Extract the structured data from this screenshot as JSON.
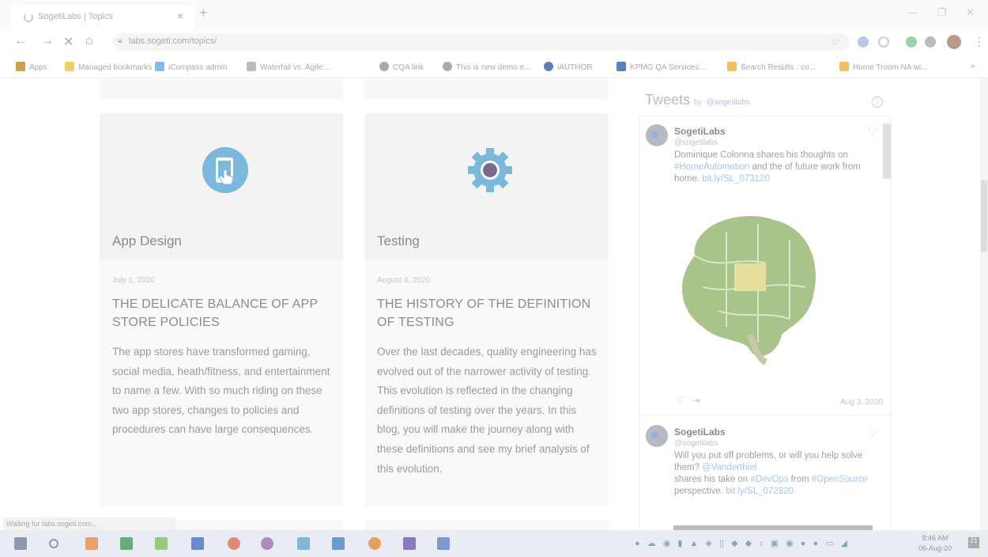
{
  "browser": {
    "tab_title": "SogetiLabs | Topics",
    "tab_close": "×",
    "new_tab": "+",
    "url": "labs.sogeti.com/topics/",
    "status_text": "Waiting for labs.sogeti.com...",
    "bookmarks": [
      {
        "label": "Apps",
        "color": "#c9a24a"
      },
      {
        "label": "Managed bookmarks",
        "color": "#f0d060"
      },
      {
        "label": "iCompass admin",
        "color": "#8ab8e6"
      },
      {
        "label": "Waterfall vs. Agile:...",
        "color": "#bbbbbb"
      },
      {
        "label": "CQA link",
        "color": "#aaaaaa"
      },
      {
        "label": "This is new demo e...",
        "color": "#aaaaaa"
      },
      {
        "label": "iAUTHOR",
        "color": "#5b7fb8"
      },
      {
        "label": "KPMG QA Services...",
        "color": "#5b7fb8"
      },
      {
        "label": "Search Results : co...",
        "color": "#f0c060"
      },
      {
        "label": "Home Troom NA wi...",
        "color": "#f0c060"
      }
    ],
    "bookmarks_more": "»"
  },
  "cards": [
    {
      "category": "App Design",
      "icon": "tablet-touch-icon",
      "date": "July 1, 2020",
      "title": "THE DELICATE BALANCE OF APP STORE POLICIES",
      "excerpt": "The app stores have transformed gaming, social media, heath/fitness, and entertainment to name a few. With so much riding on these two app stores, changes to policies and procedures can have large consequences."
    },
    {
      "category": "Testing",
      "icon": "gear-icon",
      "date": "August 4, 2020",
      "title": "THE HISTORY OF THE DEFINITION OF TESTING",
      "excerpt": "Over the last decades, quality engineering has evolved out of the narrower activity of testing. This evolution is reflected in the changing definitions of testing over the years. In this blog, you will make the journey along with these definitions and see my brief analysis of this evolution."
    }
  ],
  "tweets_widget": {
    "heading": "Tweets",
    "by": "by",
    "handle": "@sogetilabs",
    "tweets": [
      {
        "name": "SogetiLabs",
        "handle": "@sogetilabs",
        "parts": [
          "Dominique Colonna shares his thoughts on ",
          "#HomeAutomation",
          " and the of future work from home. ",
          "bit.ly/SL_073120"
        ],
        "date": "Aug 3, 2020"
      },
      {
        "name": "SogetiLabs",
        "handle": "@sogetilabs",
        "parts": [
          "Will you put off problems, or will you help solve them? ",
          "@Vanderthiel",
          " shares his take on ",
          "#DevOps",
          " from ",
          "#OpenSource",
          " perspective. ",
          "bit.ly/SL_072820"
        ]
      }
    ]
  },
  "taskbar": {
    "time": "8:46 AM",
    "date": "06-Aug-20",
    "notifications": "21"
  },
  "colors": {
    "accent_blue": "#7ab8dc",
    "gear_purple": "#7b6a8c"
  }
}
